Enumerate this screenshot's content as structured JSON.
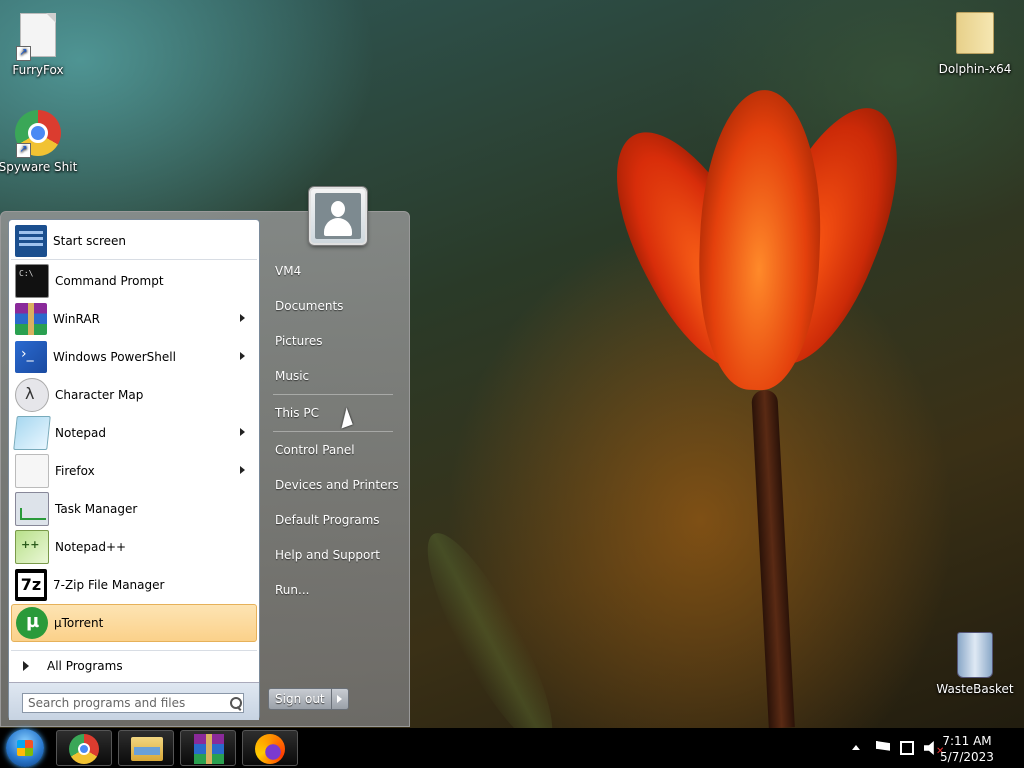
{
  "desktop": {
    "icons": [
      {
        "label": "FurryFox"
      },
      {
        "label": "Spyware Shit"
      },
      {
        "label": "Dolphin-x64"
      },
      {
        "label": "WasteBasket"
      }
    ]
  },
  "start_menu": {
    "programs": [
      {
        "label": "Start screen",
        "icon": "start-screen-icon"
      },
      {
        "label": "Command Prompt",
        "icon": "command-prompt-icon"
      },
      {
        "label": "WinRAR",
        "icon": "winrar-icon",
        "has_submenu": true
      },
      {
        "label": "Windows PowerShell",
        "icon": "powershell-icon",
        "has_submenu": true
      },
      {
        "label": "Character Map",
        "icon": "character-map-icon"
      },
      {
        "label": "Notepad",
        "icon": "notepad-icon",
        "has_submenu": true
      },
      {
        "label": "Firefox",
        "icon": "blank-file-icon",
        "has_submenu": true
      },
      {
        "label": "Task Manager",
        "icon": "task-manager-icon"
      },
      {
        "label": "Notepad++",
        "icon": "notepad-plus-plus-icon"
      },
      {
        "label": "7-Zip File Manager",
        "icon": "7zip-icon"
      },
      {
        "label": "µTorrent",
        "icon": "utorrent-icon",
        "highlighted": true
      }
    ],
    "all_programs_label": "All Programs",
    "search": {
      "placeholder": "Search programs and files",
      "value": ""
    },
    "right_items": [
      {
        "label": "VM4"
      },
      {
        "label": "Documents"
      },
      {
        "label": "Pictures"
      },
      {
        "label": "Music"
      },
      {
        "label": "This PC"
      },
      {
        "label": "Control Panel"
      },
      {
        "label": "Devices and Printers"
      },
      {
        "label": "Default Programs"
      },
      {
        "label": "Help and Support"
      },
      {
        "label": "Run..."
      }
    ],
    "sign_out_label": "Sign out"
  },
  "taskbar": {
    "pinned": [
      "chrome-icon",
      "file-explorer-icon",
      "winrar-icon",
      "firefox-icon"
    ],
    "clock": {
      "time": "7:11 AM",
      "date": "5/7/2023"
    },
    "colors": {
      "background": "#000000",
      "highlight": "#fbd18a"
    }
  }
}
